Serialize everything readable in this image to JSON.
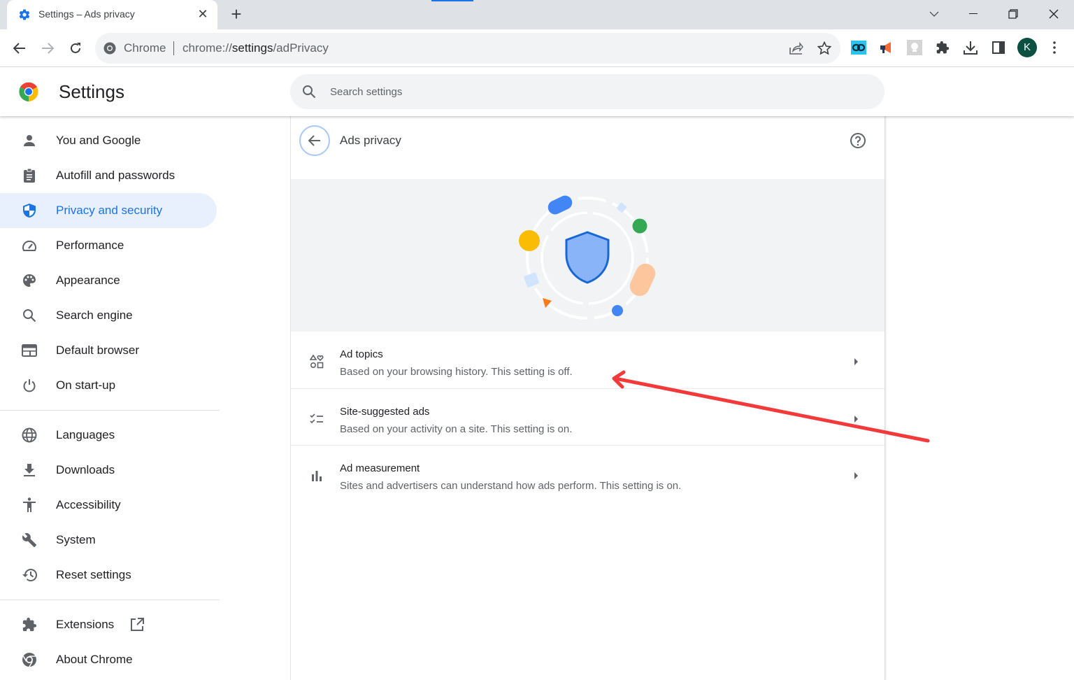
{
  "browser": {
    "tab": {
      "title": "Settings – Ads privacy",
      "icon": "gear-icon"
    },
    "new_tab_label": "+",
    "window_controls": [
      "tab-search",
      "minimize",
      "restore",
      "close"
    ],
    "omnibox": {
      "site_label": "Chrome",
      "url_prefix": "chrome://",
      "url_host": "settings",
      "url_path": "/adPrivacy"
    },
    "toolbar_icons": [
      "share-icon",
      "bookmark-star-icon",
      "link-extension-icon",
      "megaphone-extension-icon",
      "bulb-extension-icon",
      "extensions-puzzle-icon",
      "download-icon",
      "side-panel-icon"
    ],
    "profile_initial": "K",
    "profile_color": "#0b5041"
  },
  "header": {
    "title": "Settings",
    "search_placeholder": "Search settings"
  },
  "sidebar": {
    "items": [
      {
        "label": "You and Google",
        "icon": "person-icon"
      },
      {
        "label": "Autofill and passwords",
        "icon": "clipboard-icon"
      },
      {
        "label": "Privacy and security",
        "icon": "shield-icon",
        "active": true
      },
      {
        "label": "Performance",
        "icon": "speedometer-icon"
      },
      {
        "label": "Appearance",
        "icon": "palette-icon"
      },
      {
        "label": "Search engine",
        "icon": "search-icon"
      },
      {
        "label": "Default browser",
        "icon": "browser-window-icon"
      },
      {
        "label": "On start-up",
        "icon": "power-icon"
      },
      {
        "label": "Languages",
        "icon": "globe-icon"
      },
      {
        "label": "Downloads",
        "icon": "download-icon"
      },
      {
        "label": "Accessibility",
        "icon": "accessibility-icon"
      },
      {
        "label": "System",
        "icon": "wrench-icon"
      },
      {
        "label": "Reset settings",
        "icon": "history-reset-icon"
      },
      {
        "label": "Extensions",
        "icon": "puzzle-icon",
        "external": true
      },
      {
        "label": "About Chrome",
        "icon": "chrome-icon"
      }
    ]
  },
  "main": {
    "page_title": "Ads privacy",
    "rows": [
      {
        "title": "Ad topics",
        "subtitle": "Based on your browsing history. This setting is off.",
        "icon": "topics-shapes-icon"
      },
      {
        "title": "Site-suggested ads",
        "subtitle": "Based on your activity on a site. This setting is on.",
        "icon": "checklist-icon"
      },
      {
        "title": "Ad measurement",
        "subtitle": "Sites and advertisers can understand how ads perform. This setting is on.",
        "icon": "bar-chart-icon"
      }
    ]
  },
  "colors": {
    "accent": "#1a73e8",
    "active_bg": "#e8f0fe",
    "annotation_arrow": "#f23a3a"
  }
}
